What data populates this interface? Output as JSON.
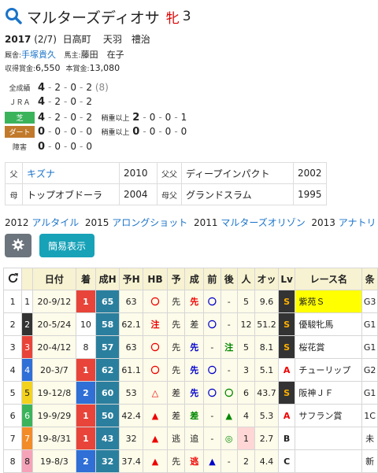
{
  "colors": {
    "link": "#1a73c8",
    "turf": "#3bb35b",
    "dirt": "#c17a2b",
    "header_bg": "#f7f2d2",
    "cell_bg": "#fdfbe9"
  },
  "header": {
    "icon": "search-icon",
    "name": "マルターズディオサ",
    "sex": "牝",
    "age": "3"
  },
  "profile": {
    "year": "2017",
    "date": "(2/7)",
    "origin": "日高町",
    "stable": "天羽　禮治"
  },
  "people": {
    "trainer_label": "厩舎:",
    "trainer": "手塚貴久",
    "owner_label": "馬主:",
    "owner": "藤田　在子"
  },
  "prize": {
    "earned_label": "収得賞金:",
    "earned": "6,550",
    "main_label": "本賞金:",
    "main": "13,080"
  },
  "records": [
    {
      "label": "全成績",
      "color": "",
      "w": "4",
      "s": "2",
      "t": "0",
      "o": "2",
      "extra": "(8)"
    },
    {
      "label": "ＪＲＡ",
      "color": "",
      "w": "4",
      "s": "2",
      "t": "0",
      "o": "2",
      "extra": ""
    },
    {
      "label": "芝",
      "color": "#3bb35b",
      "w": "4",
      "s": "2",
      "t": "0",
      "o": "2",
      "extra": "",
      "sub_label": "稍重以上",
      "sw": "2",
      "ss": "0",
      "st": "0",
      "so": "1"
    },
    {
      "label": "ダート",
      "color": "#c17a2b",
      "w": "0",
      "s": "0",
      "t": "0",
      "o": "0",
      "extra": "",
      "sub_label": "稍重以上",
      "sw": "0",
      "ss": "0",
      "st": "0",
      "so": "0"
    },
    {
      "label": "障害",
      "color": "",
      "w": "0",
      "s": "0",
      "t": "0",
      "o": "0",
      "extra": ""
    }
  ],
  "pedigree": {
    "sire_label": "父",
    "sire": "キズナ",
    "sire_year": "2010",
    "ss_label": "父父",
    "ss": "ディープインパクト",
    "ss_year": "2002",
    "dam_label": "母",
    "dam": "トップオブドーラ",
    "dam_year": "2004",
    "ds_label": "母父",
    "ds": "グランドスラム",
    "ds_year": "1995"
  },
  "siblings": [
    {
      "year": "2012",
      "name": "アルタイル"
    },
    {
      "year": "2015",
      "name": "アロングショット"
    },
    {
      "year": "2011",
      "name": "マルターズオリゾン"
    },
    {
      "year": "2013",
      "name": "アナトリ"
    }
  ],
  "buttons": {
    "settings_icon": "gear-icon",
    "simple": "簡易表示"
  },
  "table": {
    "headers": [
      "",
      "",
      "日付",
      "着",
      "成H",
      "予H",
      "HB",
      "予",
      "成",
      "前",
      "後",
      "人",
      "オッ",
      "Lv",
      "レース名",
      "条"
    ],
    "reload_icon": "reload-icon",
    "rows": [
      {
        "n": "1",
        "frame": "1",
        "fc": "#fff",
        "ft": "#222",
        "date": "20-9/12",
        "pos": "1",
        "pc": "#e8443a",
        "seih": "65",
        "yoh": "63",
        "hb": "〇",
        "hbc": "red",
        "yo": "先",
        "sei": "先",
        "seic": "red",
        "mae": "〇",
        "maec": "blue",
        "ato": "-",
        "nin": "5",
        "odds": "9.6",
        "lv": "S",
        "lvc": "#333",
        "lvt": "#ffb000",
        "race": "紫苑Ｓ",
        "yel": true,
        "jo": "G3"
      },
      {
        "n": "2",
        "frame": "2",
        "fc": "#333",
        "ft": "#fff",
        "date": "20-5/24",
        "pos": "10",
        "pc": "",
        "seih": "58",
        "yoh": "62.1",
        "hb": "注",
        "hbc": "red",
        "yo": "先",
        "sei": "差",
        "seic": "",
        "mae": "〇",
        "maec": "blue",
        "ato": "-",
        "nin": "12",
        "odds": "51.2",
        "lv": "S",
        "lvc": "#333",
        "lvt": "#ffb000",
        "race": "優駿牝馬",
        "yel": false,
        "jo": "G1"
      },
      {
        "n": "3",
        "frame": "3",
        "fc": "#e8443a",
        "ft": "#fff",
        "date": "20-4/12",
        "pos": "8",
        "pc": "",
        "seih": "57",
        "yoh": "63",
        "hb": "〇",
        "hbc": "red",
        "yo": "先",
        "sei": "先",
        "seic": "blue",
        "mae": "-",
        "maec": "",
        "ato": "注",
        "atoc": "green",
        "nin": "5",
        "odds": "8.1",
        "lv": "S",
        "lvc": "#333",
        "lvt": "#ffb000",
        "race": "桜花賞",
        "yel": false,
        "jo": "G1"
      },
      {
        "n": "4",
        "frame": "4",
        "fc": "#2f6fd6",
        "ft": "#fff",
        "date": "20-3/7",
        "pos": "1",
        "pc": "#e8443a",
        "seih": "62",
        "yoh": "61.1",
        "hb": "〇",
        "hbc": "red",
        "yo": "先",
        "sei": "先",
        "seic": "blue",
        "mae": "〇",
        "maec": "blue",
        "ato": "-",
        "nin": "3",
        "odds": "5.1",
        "lv": "A",
        "lvc": "#fff",
        "lvt": "#e00",
        "race": "チューリップ",
        "yel": false,
        "jo": "G2"
      },
      {
        "n": "5",
        "frame": "5",
        "fc": "#f3d21d",
        "ft": "#222",
        "date": "19-12/8",
        "pos": "2",
        "pc": "#2f6fd6",
        "seih": "60",
        "yoh": "53",
        "hb": "△",
        "hbc": "red",
        "yo": "差",
        "sei": "先",
        "seic": "blue",
        "mae": "〇",
        "maec": "blue",
        "ato": "〇",
        "atoc": "green",
        "nin": "6",
        "odds": "43.7",
        "lv": "S",
        "lvc": "#333",
        "lvt": "#ffb000",
        "race": "阪神ＪＦ",
        "yel": false,
        "jo": "G1"
      },
      {
        "n": "6",
        "frame": "6",
        "fc": "#3bb35b",
        "ft": "#fff",
        "date": "19-9/29",
        "pos": "1",
        "pc": "#e8443a",
        "seih": "50",
        "yoh": "42.4",
        "hb": "▲",
        "hbc": "red",
        "yo": "差",
        "sei": "差",
        "seic": "green",
        "mae": "-",
        "maec": "",
        "ato": "▲",
        "atoc": "green",
        "nin": "4",
        "odds": "5.3",
        "lv": "A",
        "lvc": "#fff",
        "lvt": "#e00",
        "race": "サフラン賞",
        "yel": false,
        "jo": "1C"
      },
      {
        "n": "7",
        "frame": "7",
        "fc": "#f28c28",
        "ft": "#fff",
        "date": "19-8/31",
        "pos": "1",
        "pc": "#e8443a",
        "seih": "43",
        "yoh": "32",
        "hb": "▲",
        "hbc": "red",
        "yo": "逃",
        "sei": "追",
        "seic": "",
        "mae": "-",
        "maec": "",
        "ato": "◎",
        "atoc": "green",
        "nin": "1",
        "ninbg": "#ffd6d6",
        "odds": "2.7",
        "lv": "B",
        "lvc": "#fff",
        "lvt": "#222",
        "race": "",
        "yel": false,
        "jo": "未"
      },
      {
        "n": "8",
        "frame": "8",
        "fc": "#f5a3b8",
        "ft": "#222",
        "date": "19-8/3",
        "pos": "2",
        "pc": "#2f6fd6",
        "seih": "32",
        "yoh": "37.4",
        "hb": "▲",
        "hbc": "red",
        "yo": "先",
        "sei": "逃",
        "seic": "red",
        "mae": "▲",
        "maec": "blue",
        "ato": "-",
        "nin": "2",
        "odds": "4.4",
        "lv": "C",
        "lvc": "#fff",
        "lvt": "#222",
        "race": "",
        "yel": false,
        "jo": "新"
      }
    ]
  }
}
